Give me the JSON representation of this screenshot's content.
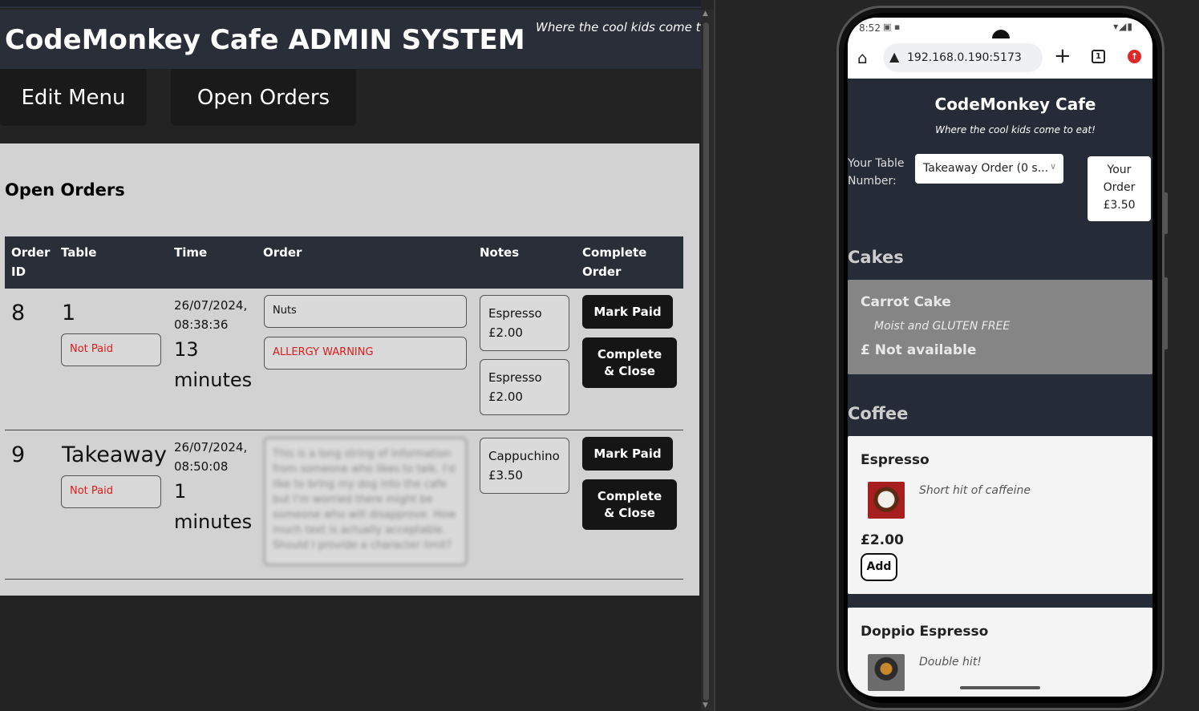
{
  "admin": {
    "title": "CodeMonkey Cafe ADMIN SYSTEM",
    "tagline": "Where the cool kids come to eat!",
    "nav": {
      "edit_menu": "Edit Menu",
      "open_orders": "Open Orders"
    },
    "panel_title": "Open Orders",
    "columns": [
      "Order ID",
      "Table",
      "Time",
      "Order",
      "Notes",
      "Complete Order"
    ],
    "orders": [
      {
        "id": "8",
        "table": "1",
        "status": "Not Paid",
        "timestamp": "26/07/2024, 08:38:36",
        "elapsed": "13 minutes",
        "order_notes": [
          "Nuts",
          "ALLERGY WARNING"
        ],
        "items": [
          {
            "name": "Espresso",
            "price": "£2.00"
          },
          {
            "name": "Espresso",
            "price": "£2.00"
          }
        ],
        "mark_paid": "Mark Paid",
        "complete_close": "Complete & Close"
      },
      {
        "id": "9",
        "table": "Takeaway",
        "status": "Not Paid",
        "timestamp": "26/07/2024, 08:50:08",
        "elapsed": "1 minutes",
        "order_notes": [
          "This is a long string of information from someone who likes to talk. I'd like to bring my dog into the cafe but I'm worried there might be someone who will disapprove. How much text is actually acceptable. Should I provide a character limit?"
        ],
        "items": [
          {
            "name": "Cappuchino",
            "price": "£3.50"
          }
        ],
        "mark_paid": "Mark Paid",
        "complete_close": "Complete & Close"
      }
    ]
  },
  "phone": {
    "status_time": "8:52",
    "url": "192.168.0.190:5173",
    "tab_count": "1",
    "cafe_title": "CodeMonkey Cafe",
    "cafe_tagline": "Where the cool kids come to eat!",
    "table_label": "Your Table Number:",
    "table_select": "Takeaway Order (0 s...",
    "your_order": {
      "line1": "Your",
      "line2": "Order",
      "total": "£3.50"
    },
    "categories": [
      {
        "name": "Cakes",
        "items": [
          {
            "name": "Carrot Cake",
            "description": "Moist and GLUTEN FREE",
            "price": "£ Not available",
            "available": false
          }
        ]
      },
      {
        "name": "Coffee",
        "items": [
          {
            "name": "Espresso",
            "description": "Short hit of caffeine",
            "price": "£2.00",
            "add_label": "Add",
            "image": "espresso-cup-photo"
          },
          {
            "name": "Doppio Espresso",
            "description": "Double hit!",
            "image": "doppio-espresso-photo"
          }
        ]
      }
    ]
  },
  "colors": {
    "admin_header": "#2a2e38",
    "panel_bg": "#d2d2d2",
    "not_paid_red": "#e21a1a",
    "phone_page_bg": "#252b37",
    "unavailable_card": "#858585"
  }
}
